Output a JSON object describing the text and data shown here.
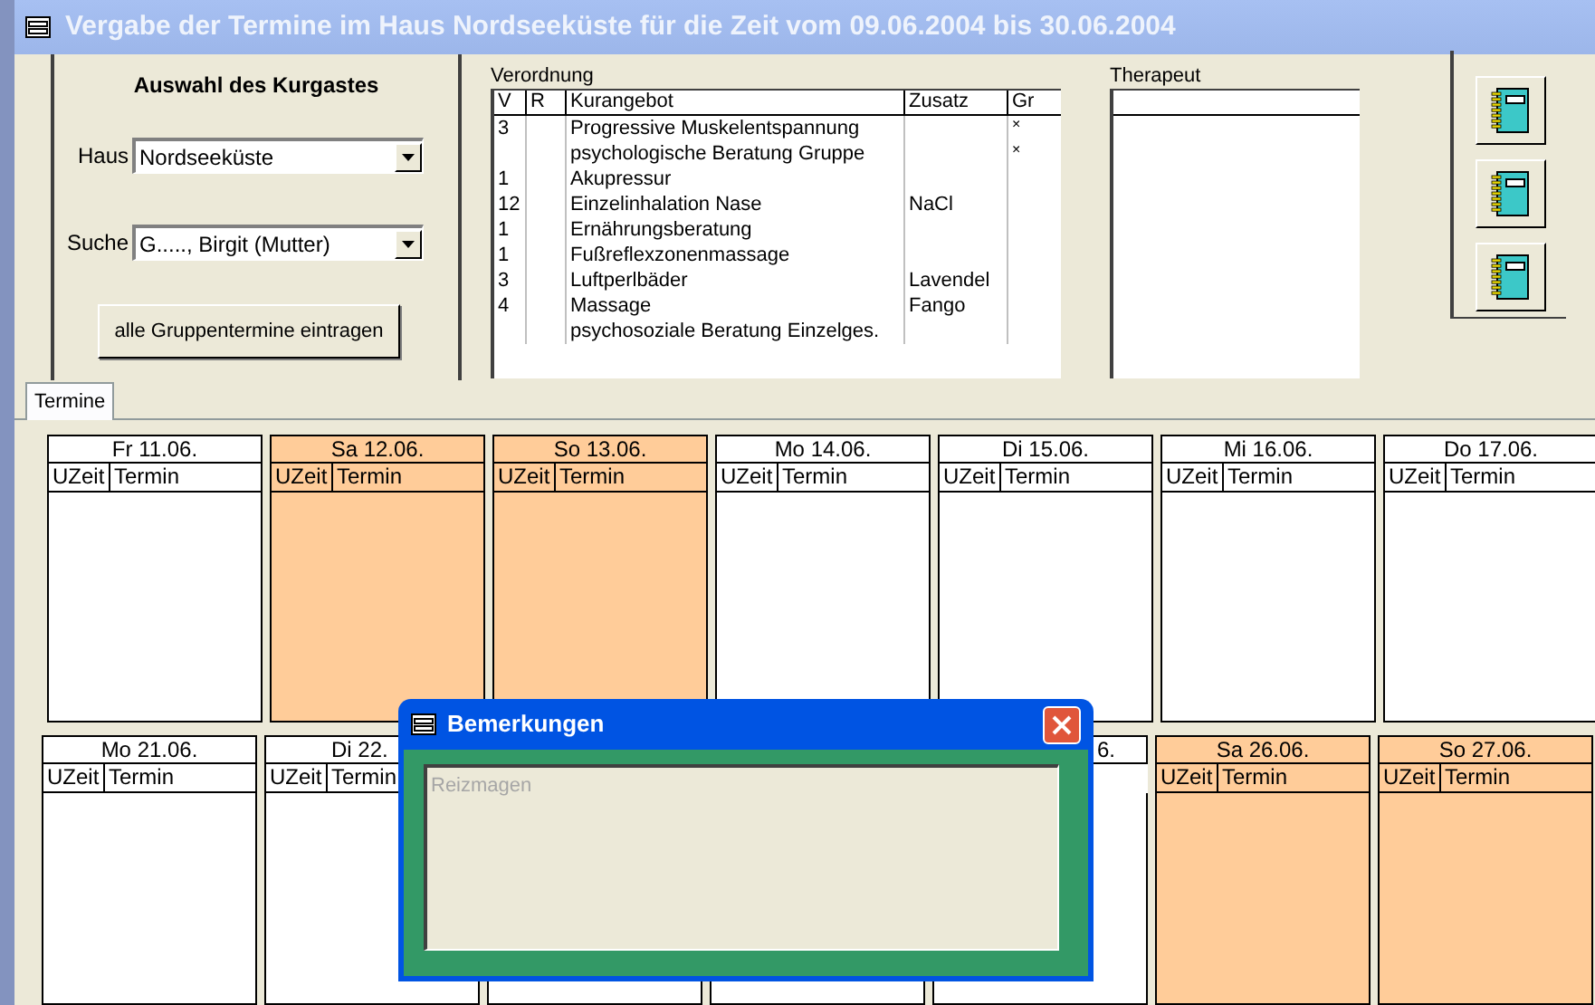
{
  "window": {
    "title": "Vergabe der Termine im Haus Nordseeküste für die Zeit vom 09.06.2004 bis 30.06.2004"
  },
  "guest_panel": {
    "heading": "Auswahl des Kurgastes",
    "fields": [
      {
        "label": "Haus",
        "value": "Nordseeküste"
      },
      {
        "label": "Suche",
        "value": "G....., Birgit (Mutter)"
      }
    ],
    "button": "alle Gruppentermine eintragen"
  },
  "prescription": {
    "title": "Verordnung",
    "columns": [
      "V",
      "R",
      "Kurangebot",
      "Zusatz",
      "Gr"
    ],
    "rows": [
      [
        "3",
        "",
        "Progressive Muskelentspannung",
        "",
        "×"
      ],
      [
        "",
        "",
        "psychologische Beratung Gruppe",
        "",
        "×"
      ],
      [
        "1",
        "",
        "Akupressur",
        "",
        ""
      ],
      [
        "12",
        "",
        "Einzelinhalation Nase",
        "NaCl",
        ""
      ],
      [
        "1",
        "",
        "Ernährungsberatung",
        "",
        ""
      ],
      [
        "1",
        "",
        "Fußreflexzonenmassage",
        "",
        ""
      ],
      [
        "3",
        "",
        "Luftperlbäder",
        "Lavendel",
        ""
      ],
      [
        "4",
        "",
        "Massage",
        "Fango",
        ""
      ],
      [
        "",
        "",
        "psychosoziale Beratung Einzelges.",
        "",
        ""
      ]
    ]
  },
  "therapist": {
    "title": "Therapeut"
  },
  "side_buttons": [
    {
      "kind": "notebook"
    },
    {
      "kind": "notebook"
    },
    {
      "kind": "notebook"
    }
  ],
  "tabs": [
    {
      "label": "Termine",
      "selected": true
    }
  ],
  "weeks": [
    [
      {
        "label": "Fr  11.06.",
        "weekend": false,
        "columns": [
          "UZeit",
          "Termin"
        ]
      },
      {
        "label": "Sa  12.06.",
        "weekend": true,
        "columns": [
          "UZeit",
          "Termin"
        ]
      },
      {
        "label": "So  13.06.",
        "weekend": true,
        "columns": [
          "UZeit",
          "Termin"
        ]
      },
      {
        "label": "Mo  14.06.",
        "weekend": false,
        "columns": [
          "UZeit",
          "Termin"
        ]
      },
      {
        "label": "Di  15.06.",
        "weekend": false,
        "columns": [
          "UZeit",
          "Termin"
        ]
      },
      {
        "label": "Mi  16.06.",
        "weekend": false,
        "columns": [
          "UZeit",
          "Termin"
        ]
      },
      {
        "label": "Do  17.06.",
        "weekend": false,
        "columns": [
          "UZeit",
          "Termin"
        ]
      }
    ],
    [
      {
        "label": "Mo  21.06.",
        "weekend": false,
        "columns": [
          "UZeit",
          "Termin"
        ]
      },
      {
        "label": "Di  22.",
        "cut_right": true,
        "weekend": false,
        "columns": [
          "UZeit",
          "Termin"
        ]
      },
      {
        "weekend": false
      },
      {
        "weekend": false
      },
      {
        "label": "6.",
        "cut_left": true,
        "weekend": false
      },
      {
        "label": "Sa  26.06.",
        "weekend": true,
        "columns": [
          "UZeit",
          "Termin"
        ]
      },
      {
        "label": "So  27.06.",
        "weekend": true,
        "columns": [
          "UZeit",
          "Termin"
        ]
      }
    ]
  ],
  "dialog": {
    "title": "Bemerkungen",
    "placeholder": "Reizmagen"
  }
}
